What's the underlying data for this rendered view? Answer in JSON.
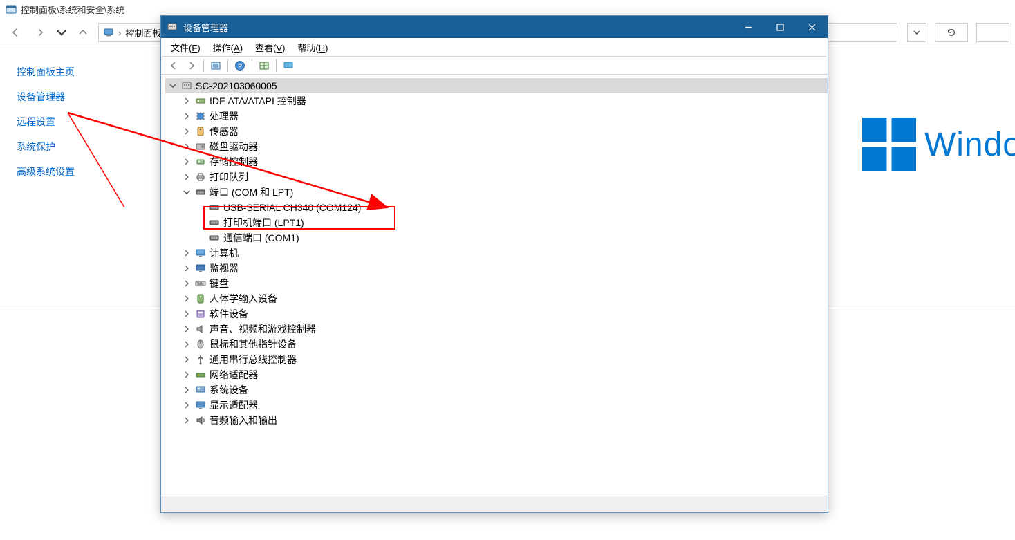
{
  "controlPanel": {
    "title": "控制面板\\系统和安全\\系统",
    "breadcrumb": "控制面板",
    "sidebar": [
      "控制面板主页",
      "设备管理器",
      "远程设置",
      "系统保护",
      "高级系统设置"
    ],
    "windowsBrand": "Windo"
  },
  "deviceManager": {
    "title": "设备管理器",
    "menu": {
      "file": {
        "label": "文件",
        "accel": "F"
      },
      "action": {
        "label": "操作",
        "accel": "A"
      },
      "view": {
        "label": "查看",
        "accel": "V"
      },
      "help": {
        "label": "帮助",
        "accel": "H"
      }
    },
    "tree": {
      "root": "SC-202103060005",
      "items": [
        {
          "label": "IDE ATA/ATAPI 控制器",
          "icon": "ide",
          "exp": "closed"
        },
        {
          "label": "处理器",
          "icon": "cpu",
          "exp": "closed"
        },
        {
          "label": "传感器",
          "icon": "sensor",
          "exp": "closed"
        },
        {
          "label": "磁盘驱动器",
          "icon": "disk",
          "exp": "closed"
        },
        {
          "label": "存储控制器",
          "icon": "storage",
          "exp": "closed"
        },
        {
          "label": "打印队列",
          "icon": "printer",
          "exp": "closed"
        },
        {
          "label": "端口 (COM 和 LPT)",
          "icon": "port",
          "exp": "open",
          "children": [
            {
              "label": "USB-SERIAL CH340 (COM124)",
              "icon": "port"
            },
            {
              "label": "打印机端口 (LPT1)",
              "icon": "port"
            },
            {
              "label": "通信端口 (COM1)",
              "icon": "port"
            }
          ]
        },
        {
          "label": "计算机",
          "icon": "computer",
          "exp": "closed"
        },
        {
          "label": "监视器",
          "icon": "monitor",
          "exp": "closed"
        },
        {
          "label": "键盘",
          "icon": "keyboard",
          "exp": "closed"
        },
        {
          "label": "人体学输入设备",
          "icon": "hid",
          "exp": "closed"
        },
        {
          "label": "软件设备",
          "icon": "software",
          "exp": "closed"
        },
        {
          "label": "声音、视频和游戏控制器",
          "icon": "sound",
          "exp": "closed"
        },
        {
          "label": "鼠标和其他指针设备",
          "icon": "mouse",
          "exp": "closed"
        },
        {
          "label": "通用串行总线控制器",
          "icon": "usb",
          "exp": "closed"
        },
        {
          "label": "网络适配器",
          "icon": "network",
          "exp": "closed"
        },
        {
          "label": "系统设备",
          "icon": "system",
          "exp": "closed"
        },
        {
          "label": "显示适配器",
          "icon": "display",
          "exp": "closed"
        },
        {
          "label": "音频输入和输出",
          "icon": "audio",
          "exp": "closed"
        }
      ]
    }
  },
  "annotation": {
    "highlight": "USB-SERIAL CH340 (COM124)",
    "arrowFrom": "设备管理器 sidebar link",
    "arrowTo": "端口 (COM 和 LPT)"
  }
}
